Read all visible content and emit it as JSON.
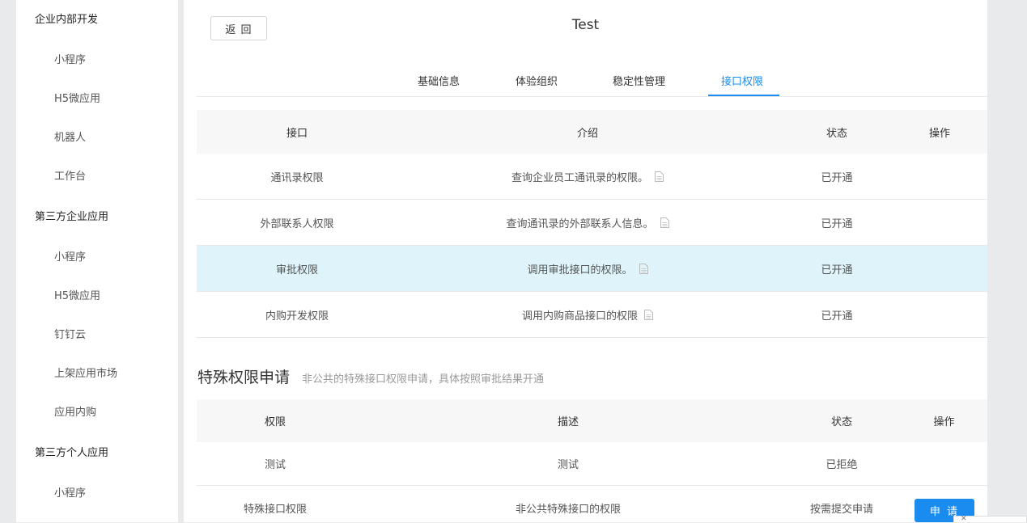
{
  "sidebar": {
    "groups": [
      {
        "title": "企业内部开发",
        "items": [
          "小程序",
          "H5微应用",
          "机器人",
          "工作台"
        ]
      },
      {
        "title": "第三方企业应用",
        "items": [
          "小程序",
          "H5微应用",
          "钉钉云",
          "上架应用市场",
          "应用内购"
        ]
      },
      {
        "title": "第三方个人应用",
        "items": [
          "小程序"
        ]
      }
    ]
  },
  "header": {
    "back_label": "返 回",
    "title": "Test"
  },
  "tabs": [
    {
      "label": "基础信息",
      "active": false
    },
    {
      "label": "体验组织",
      "active": false
    },
    {
      "label": "稳定性管理",
      "active": false
    },
    {
      "label": "接口权限",
      "active": true
    }
  ],
  "api_table": {
    "columns": [
      "接口",
      "介绍",
      "状态",
      "操作"
    ],
    "rows": [
      {
        "name": "通讯录权限",
        "desc": "查询企业员工通讯录的权限。",
        "status": "已开通",
        "highlighted": false
      },
      {
        "name": "外部联系人权限",
        "desc": "查询通讯录的外部联系人信息。",
        "status": "已开通",
        "highlighted": false
      },
      {
        "name": "审批权限",
        "desc": "调用审批接口的权限。",
        "status": "已开通",
        "highlighted": true
      },
      {
        "name": "内购开发权限",
        "desc": "调用内购商品接口的权限",
        "status": "已开通",
        "highlighted": false
      }
    ]
  },
  "special": {
    "title": "特殊权限申请",
    "subtitle": "非公共的特殊接口权限申请，具体按照审批结果开通",
    "columns": [
      "权限",
      "描述",
      "状态",
      "操作"
    ],
    "rows": [
      {
        "name": "测试",
        "desc": "测试",
        "status": "已拒绝",
        "action": ""
      },
      {
        "name": "特殊接口权限",
        "desc": "非公共特殊接口的权限",
        "status": "按需提交申请",
        "action": "申 请"
      }
    ]
  },
  "colors": {
    "accent": "#1a8cf0",
    "highlight_row": "#def4fa",
    "header_bg": "#f7f7f7"
  }
}
